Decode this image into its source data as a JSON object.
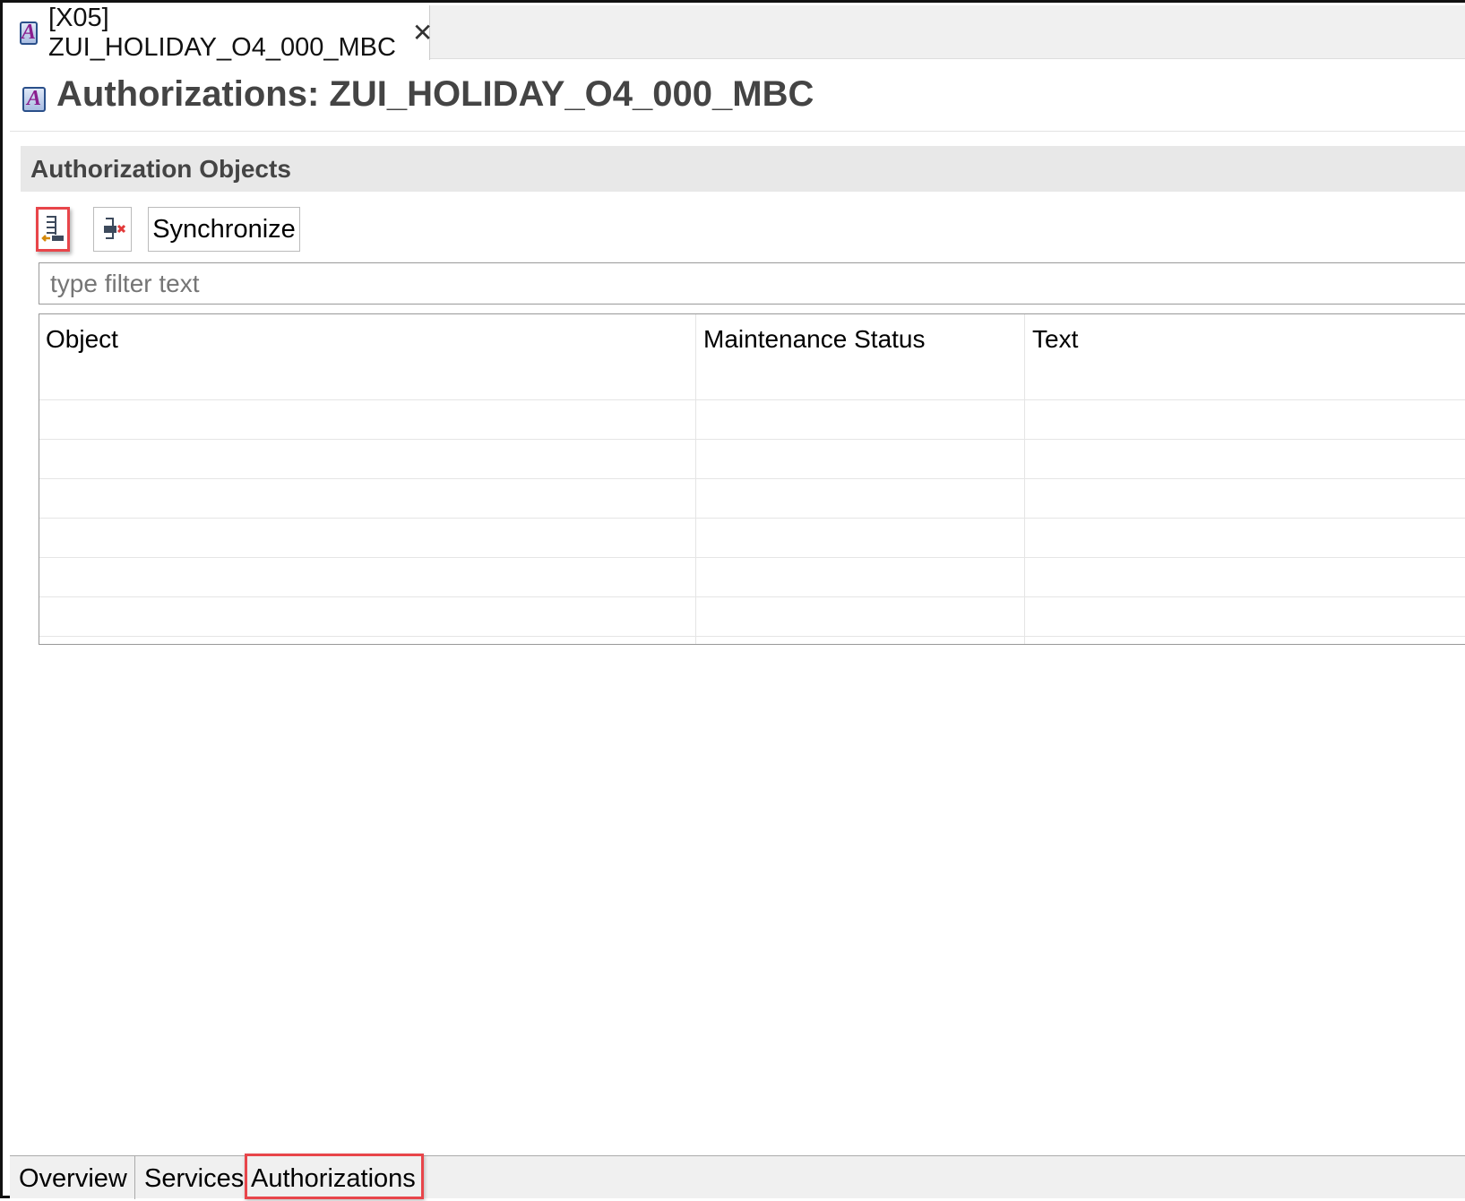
{
  "editor_tab": {
    "label": "[X05] ZUI_HOLIDAY_O4_000_MBC",
    "icon": "abap-object-icon",
    "close_icon": "close-icon"
  },
  "page_title": "Authorizations: ZUI_HOLIDAY_O4_000_MBC",
  "section": {
    "title": "Authorization Objects"
  },
  "toolbar": {
    "add_icon": "add-authorization-object-icon",
    "remove_icon": "remove-authorization-object-icon",
    "synchronize_label": "Synchronize"
  },
  "filter": {
    "placeholder": "type filter text",
    "value": ""
  },
  "table": {
    "columns": [
      "Object",
      "Maintenance Status",
      "Text"
    ],
    "rows": []
  },
  "bottom_tabs": [
    {
      "label": "Overview"
    },
    {
      "label": "Services"
    },
    {
      "label": "Authorizations",
      "active": true
    }
  ],
  "colors": {
    "highlight": "#e8454a",
    "section_bg": "#e8e8e8"
  }
}
